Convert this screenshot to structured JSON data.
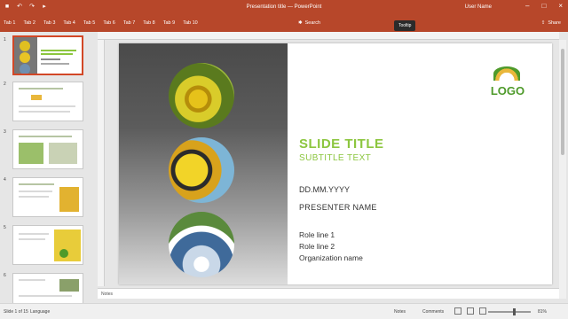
{
  "titlebar": {
    "doc_title": "Presentation title — PowerPoint",
    "user_name": "User Name",
    "qat": [
      "save-icon",
      "undo-icon",
      "redo-icon",
      "start-icon"
    ],
    "window_controls": [
      "minimize-icon",
      "maximize-icon",
      "close-icon"
    ]
  },
  "menu": {
    "tabs": [
      "Tab 1",
      "Tab 2",
      "Tab 3",
      "Tab 4",
      "Tab 5",
      "Tab 6",
      "Tab 7",
      "Tab 8",
      "Tab 9",
      "Tab 10"
    ],
    "tell_me": "Search",
    "share": "Share"
  },
  "thumbnails": {
    "numbers": [
      "1",
      "2",
      "3",
      "4",
      "5",
      "6"
    ]
  },
  "slide": {
    "logo_text": "LOGO",
    "tooltip": "Tooltip",
    "title": "SLIDE TITLE",
    "subtitle": "SUBTITLE TEXT",
    "date": "DD.MM.YYYY",
    "name": "PRESENTER NAME",
    "role_line1": "Role line 1",
    "role_line2": "Role line 2",
    "role_line3": "Organization name",
    "title_color": "#8cc63f",
    "logo_color": "#4e9a2a"
  },
  "notes": {
    "placeholder": "Notes"
  },
  "status": {
    "slide_count": "Slide 1 of 15",
    "language": "Language",
    "notes_label": "Notes",
    "comments_label": "Comments",
    "zoom": "81%"
  },
  "colors": {
    "accent": "#b7472a"
  }
}
